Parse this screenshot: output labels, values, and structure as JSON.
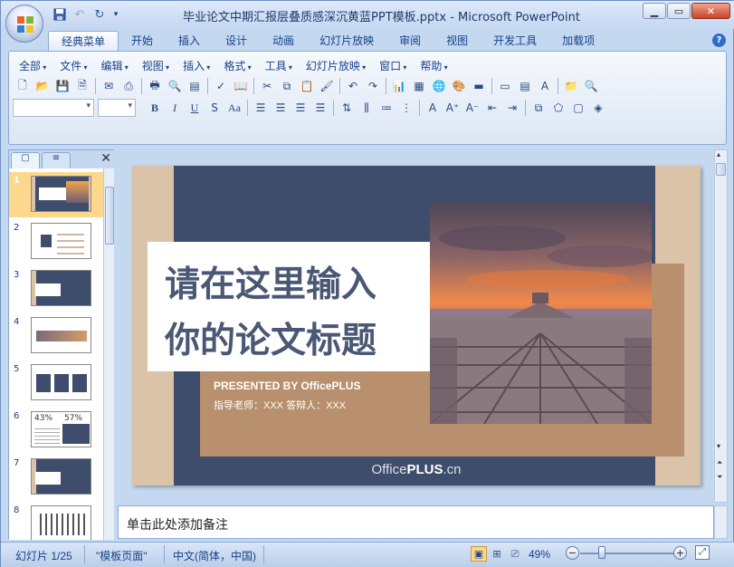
{
  "window": {
    "title": "毕业论文中期汇报层叠质感深沉黄蓝PPT模板.pptx - Microsoft PowerPoint",
    "minimize_icon": "minimize-icon",
    "maximize_icon": "restore-icon",
    "close_icon": "close-icon"
  },
  "quick_access": [
    "save-icon",
    "undo-icon",
    "redo-icon",
    "customize-icon"
  ],
  "tabs": [
    "经典菜单",
    "开始",
    "插入",
    "设计",
    "动画",
    "幻灯片放映",
    "审阅",
    "视图",
    "开发工具",
    "加载项"
  ],
  "active_tab": "经典菜单",
  "classic_menu": [
    "全部",
    "文件",
    "编辑",
    "视图",
    "插入",
    "格式",
    "工具",
    "幻灯片放映",
    "窗口",
    "帮助"
  ],
  "slides": [
    {
      "num": "1"
    },
    {
      "num": "2"
    },
    {
      "num": "3"
    },
    {
      "num": "4"
    },
    {
      "num": "5"
    },
    {
      "num": "6"
    },
    {
      "num": "7"
    },
    {
      "num": "8"
    }
  ],
  "thumb6": {
    "left_pct": "43%",
    "right_pct": "57%"
  },
  "slide": {
    "title_line1": "请在这里输入",
    "title_line2": "你的论文标题",
    "presented_by": "PRESENTED BY OfficePLUS",
    "advisor": "指导老师：XXX  答辩人：XXX",
    "brand_plain": "Office",
    "brand_bold": "PLUS",
    "brand_suffix": ".cn",
    "colors": {
      "navy": "#3f4d6c",
      "tan": "#b8906d",
      "beige": "#dac3a8",
      "title": "#4a5874"
    }
  },
  "notes_placeholder": "单击此处添加备注",
  "status": {
    "slide_info": "幻灯片 1/25",
    "theme": "\"模板页面\"",
    "language": "中文(简体，中国)",
    "zoom": "49%"
  }
}
